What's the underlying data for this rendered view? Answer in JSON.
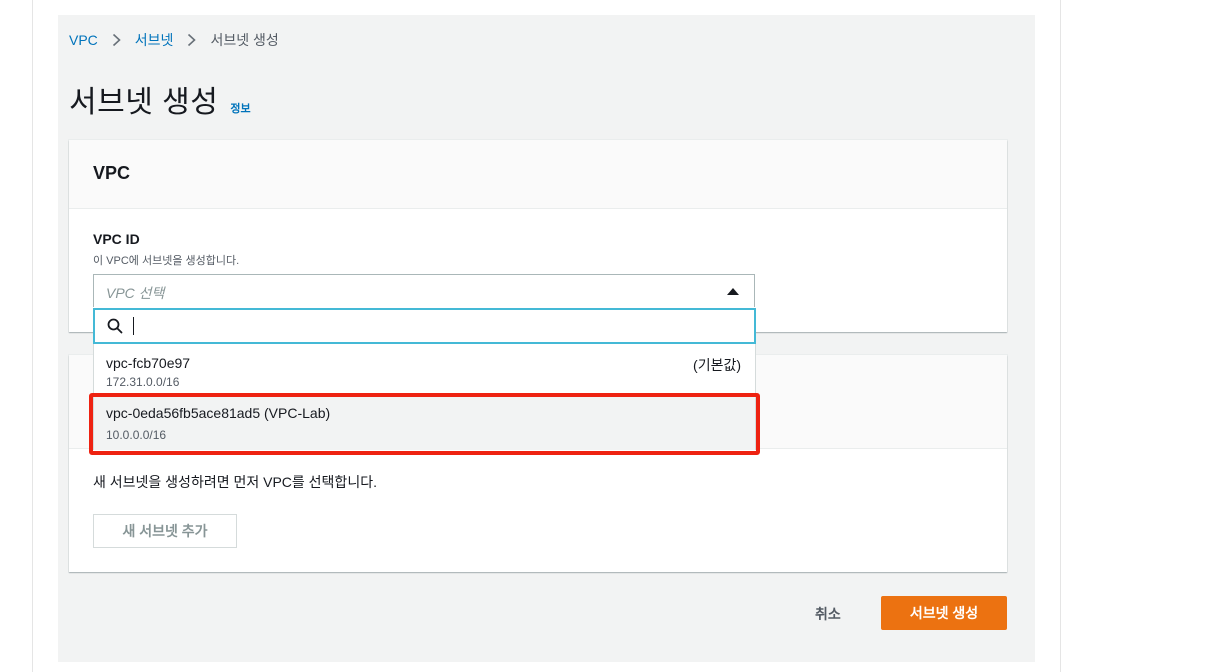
{
  "breadcrumb": {
    "items": [
      {
        "label": "VPC"
      },
      {
        "label": "서브넷"
      },
      {
        "label": "서브넷 생성"
      }
    ]
  },
  "page": {
    "title": "서브넷 생성",
    "info_link": "정보"
  },
  "vpc_section": {
    "title": "VPC",
    "field_label": "VPC ID",
    "field_description": "이 VPC에 서브넷을 생성합니다.",
    "select_placeholder": "VPC 선택",
    "search_value": "",
    "options": [
      {
        "name": "vpc-fcb70e97",
        "cidr": "172.31.0.0/16",
        "tag": "(기본값)"
      },
      {
        "name": "vpc-0eda56fb5ace81ad5 (VPC-Lab)",
        "cidr": "10.0.0.0/16",
        "tag": ""
      }
    ]
  },
  "subnet_section": {
    "message": "새 서브넷을 생성하려면 먼저 VPC를 선택합니다.",
    "add_button": "새 서브넷 추가"
  },
  "footer": {
    "cancel_label": "취소",
    "submit_label": "서브넷 생성"
  },
  "colors": {
    "link": "#0073bb",
    "primary": "#ec7211",
    "focus": "#44b9d6",
    "highlight": "#ee2211"
  }
}
